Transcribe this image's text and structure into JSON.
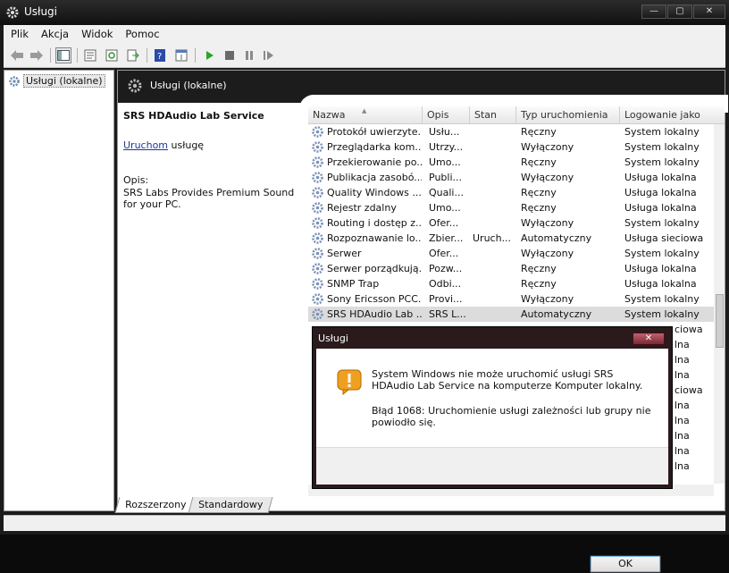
{
  "window": {
    "title": "Usługi",
    "buttons": {
      "minimize": "—",
      "maximize": "▢",
      "close": "✕"
    }
  },
  "menu": [
    "Plik",
    "Akcja",
    "Widok",
    "Pomoc"
  ],
  "toolbar_icons": [
    "back-arrow-icon",
    "forward-arrow-icon",
    "show-tree-icon",
    "properties-icon",
    "refresh-icon",
    "export-icon",
    "help-icon",
    "console-icon",
    "play-icon",
    "stop-icon",
    "pause-icon",
    "resume-icon"
  ],
  "tree": {
    "item": "Usługi (lokalne)"
  },
  "main": {
    "header": "Usługi (lokalne)",
    "service_name": "SRS HDAudio Lab Service",
    "start_link": "Uruchom",
    "start_suffix": " usługę",
    "opis_label": "Opis:",
    "description": "SRS Labs Provides Premium Sound for your PC."
  },
  "columns": [
    "Nazwa",
    "Opis",
    "Stan",
    "Typ uruchomienia",
    "Logowanie jako"
  ],
  "rows": [
    {
      "name": "Protokół uwierzyte...",
      "desc": "Usłu...",
      "state": "",
      "startup": "Ręczny",
      "logon": "System lokalny"
    },
    {
      "name": "Przeglądarka kom...",
      "desc": "Utrzy...",
      "state": "",
      "startup": "Wyłączony",
      "logon": "System lokalny"
    },
    {
      "name": "Przekierowanie po...",
      "desc": "Umo...",
      "state": "",
      "startup": "Ręczny",
      "logon": "System lokalny"
    },
    {
      "name": "Publikacja zasobó...",
      "desc": "Publi...",
      "state": "",
      "startup": "Wyłączony",
      "logon": "Usługa lokalna"
    },
    {
      "name": "Quality Windows ...",
      "desc": "Quali...",
      "state": "",
      "startup": "Ręczny",
      "logon": "Usługa lokalna"
    },
    {
      "name": "Rejestr zdalny",
      "desc": "Umo...",
      "state": "",
      "startup": "Ręczny",
      "logon": "Usługa lokalna"
    },
    {
      "name": "Routing i dostęp z...",
      "desc": "Ofer...",
      "state": "",
      "startup": "Wyłączony",
      "logon": "System lokalny"
    },
    {
      "name": "Rozpoznawanie lo...",
      "desc": "Zbier...",
      "state": "Uruch...",
      "startup": "Automatyczny",
      "logon": "Usługa sieciowa"
    },
    {
      "name": "Serwer",
      "desc": "Ofer...",
      "state": "",
      "startup": "Wyłączony",
      "logon": "System lokalny"
    },
    {
      "name": "Serwer porządkują...",
      "desc": "Pozw...",
      "state": "",
      "startup": "Ręczny",
      "logon": "Usługa lokalna"
    },
    {
      "name": "SNMP Trap",
      "desc": "Odbi...",
      "state": "",
      "startup": "Ręczny",
      "logon": "Usługa lokalna"
    },
    {
      "name": "Sony Ericsson PCC...",
      "desc": "Provi...",
      "state": "",
      "startup": "Wyłączony",
      "logon": "System lokalny"
    },
    {
      "name": "SRS HDAudio Lab ...",
      "desc": "SRS L...",
      "state": "",
      "startup": "Automatyczny",
      "logon": "System lokalny",
      "selected": true
    }
  ],
  "partial_logons": [
    "ciowa",
    "lna",
    "lna",
    "lna",
    "ciowa",
    "lna",
    "lna",
    "lna",
    "lna",
    "lna"
  ],
  "tabs": [
    "Rozszerzony",
    "Standardowy"
  ],
  "dialog": {
    "title": "Usługi",
    "close": "✕",
    "message1": "System Windows nie może uruchomić usługi SRS HDAudio Lab Service na komputerze Komputer lokalny.",
    "message2": "Błąd 1068: Uruchomienie usługi zależności lub grupy nie powiodło się.",
    "ok": "OK"
  }
}
